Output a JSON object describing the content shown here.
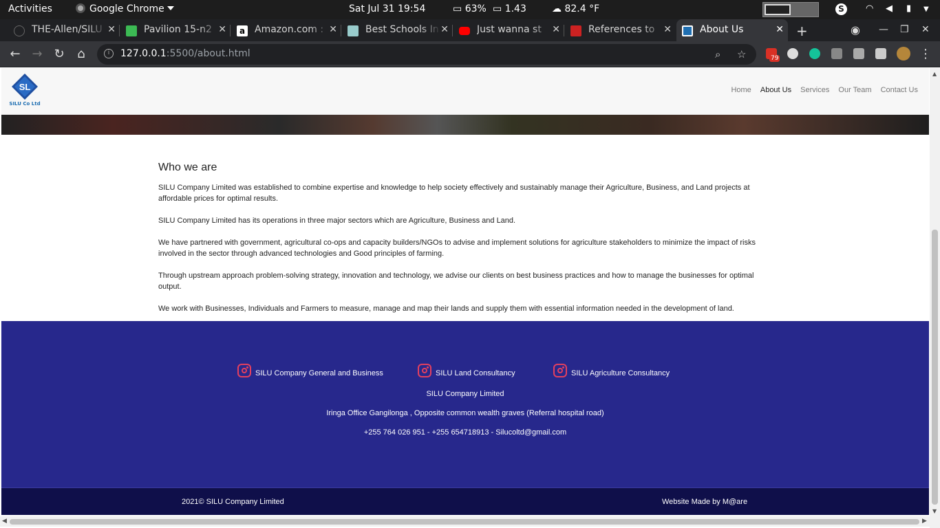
{
  "desktop": {
    "activities": "Activities",
    "app_name": "Google Chrome",
    "clock": "Sat Jul 31  19:54",
    "battery": "63%",
    "load": "1.43",
    "weather": "82.4 °F"
  },
  "browser": {
    "tabs": [
      {
        "title": "THE-Allen/SILU",
        "favicon_color": "#202124"
      },
      {
        "title": "Pavilion 15-n2",
        "favicon_color": "#3cba54"
      },
      {
        "title": "Amazon.com :",
        "favicon_color": "#ffffff"
      },
      {
        "title": "Best Schools In",
        "favicon_color": "#9cc"
      },
      {
        "title": "Just wanna st",
        "favicon_color": "#ff0000"
      },
      {
        "title": "References to",
        "favicon_color": "#cc2222"
      },
      {
        "title": "About Us",
        "favicon_color": "#1f6fb2"
      }
    ],
    "url_host": "127.0.0.1",
    "url_path": ":5500/about.html",
    "ext_badge": "79"
  },
  "site": {
    "logo_text": "SL",
    "logo_caption": "SILU Co Ltd",
    "nav": [
      "Home",
      "About Us",
      "Services",
      "Our Team",
      "Contact Us"
    ],
    "about": {
      "heading": "Who we are",
      "paragraphs": [
        "SILU Company Limited was established to combine expertise and knowledge to help society effectively and sustainably manage their Agriculture, Business, and Land projects at affordable prices for optimal results.",
        "SILU Company Limited has its operations in three major sectors which are Agriculture, Business and Land.",
        "We have partnered with government, agricultural co-ops and capacity builders/NGOs to advise and implement solutions for agriculture stakeholders to minimize the impact of risks involved in the sector through advanced technologies and Good principles of farming.",
        "Through upstream approach problem-solving strategy, innovation and technology, we advise our clients on best business practices and how to manage the businesses for optimal output.",
        "We work with Businesses, Individuals and Farmers to measure, manage and map their lands and supply them with essential information needed in the development of land."
      ]
    },
    "footer": {
      "social": [
        "SILU Company General and Business",
        "SILU Land Consultancy",
        "SILU Agriculture Consultancy"
      ],
      "company": "SILU Company Limited",
      "address": "Iringa Office Gangilonga , Opposite common wealth graves (Referral hospital road)",
      "contact": "+255 764 026 951 - +255 654718913 - Silucoltd@gmail.com",
      "copyright": "2021© SILU Company Limited",
      "credit": "Website Made by M@are"
    }
  },
  "colors": {
    "footer_bg": "#27288c",
    "footer_bottom_bg": "#0f0f4a",
    "instagram": "#e4405f"
  }
}
